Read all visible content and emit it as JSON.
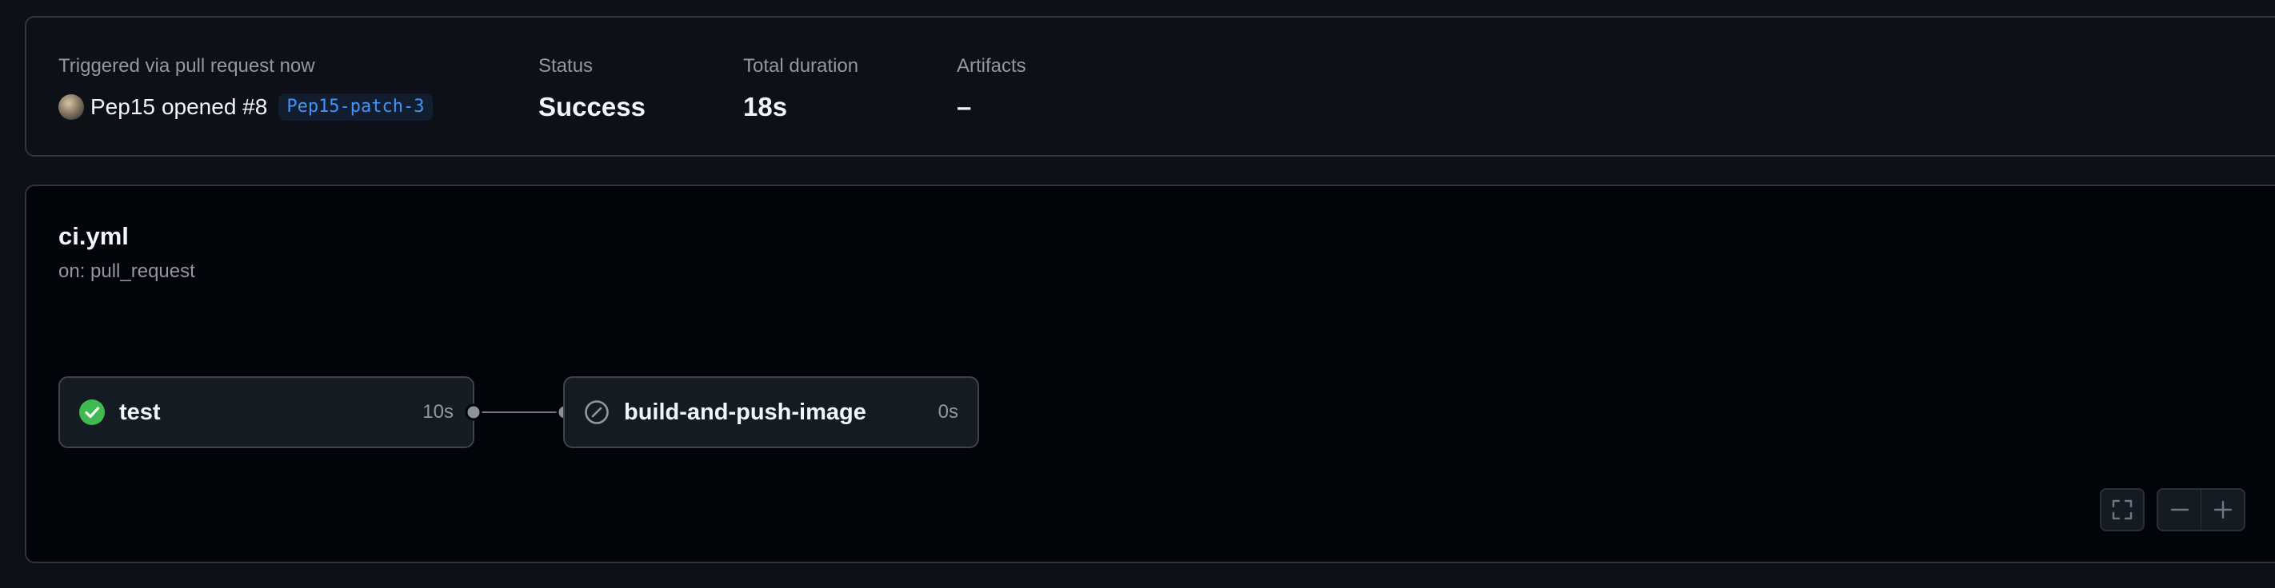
{
  "summary": {
    "trigger_label": "Triggered via pull request now",
    "trigger_user": "Pep15",
    "trigger_action": "opened #8",
    "branch": "Pep15-patch-3",
    "status_label": "Status",
    "status_value": "Success",
    "duration_label": "Total duration",
    "duration_value": "18s",
    "artifacts_label": "Artifacts",
    "artifacts_value": "–"
  },
  "workflow": {
    "name": "ci.yml",
    "trigger": "on: pull_request",
    "jobs": [
      {
        "name": "test",
        "duration": "10s",
        "status": "success",
        "icon": "check-circle-icon"
      },
      {
        "name": "build-and-push-image",
        "duration": "0s",
        "status": "skipped",
        "icon": "skipped-icon"
      }
    ]
  },
  "controls": {
    "fullscreen_icon": "fullscreen-icon",
    "zoom_out_icon": "zoom-out-icon",
    "zoom_in_icon": "zoom-in-icon"
  },
  "colors": {
    "success": "#3fb950",
    "muted": "#9198a1",
    "link": "#4493f8"
  }
}
